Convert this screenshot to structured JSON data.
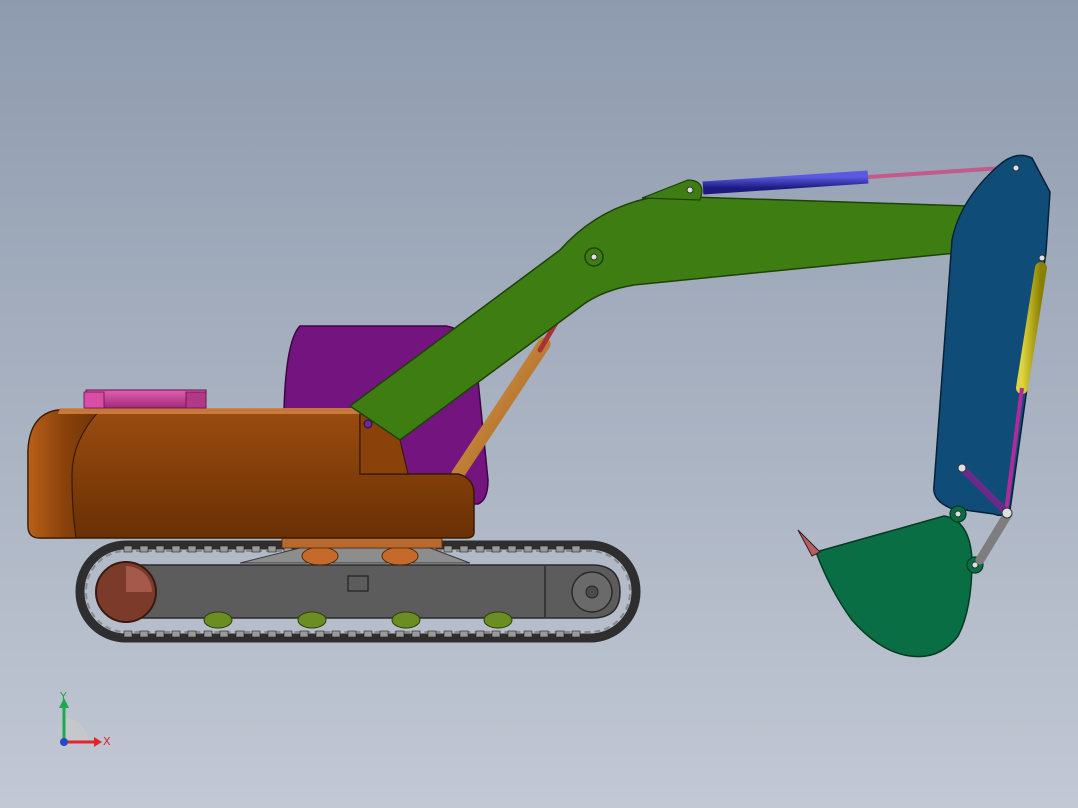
{
  "viewport": {
    "background_top": "#8e9bae",
    "background_bottom": "#c2c8d4"
  },
  "triad": {
    "x_label": "X",
    "y_label": "Y",
    "x_color": "#e0262a",
    "y_color": "#1fa84a",
    "z_color": "#2848c8"
  },
  "model": {
    "components": [
      "counterweight",
      "upper-structure",
      "engine-cover",
      "cab",
      "track-chain",
      "track-frame",
      "boom",
      "boom-cylinder",
      "stick",
      "stick-cylinder",
      "bucket-cylinder",
      "bucket-linkage",
      "bucket"
    ],
    "colors": {
      "upper_body": "#7a3a06",
      "upper_body_light": "#a95a12",
      "engine_cover": "#c8409a",
      "cab": "#74147e",
      "boom": "#3e7d12",
      "stick": "#0f4d78",
      "bucket": "#0a6e44",
      "track_frame": "#5a5a5a",
      "track_chain": "#3a3a3a",
      "roller": "#6b8e23",
      "boom_cylinder": "#c07a2a",
      "boom_rod": "#a83232",
      "stick_cylinder": "#2a2ab0",
      "stick_rod": "#c25a8a",
      "bucket_cylinder": "#b3a800",
      "bucket_rod": "#b02a9a",
      "linkage_link": "#7d7d7d",
      "pin": "#9aa0a8"
    }
  }
}
